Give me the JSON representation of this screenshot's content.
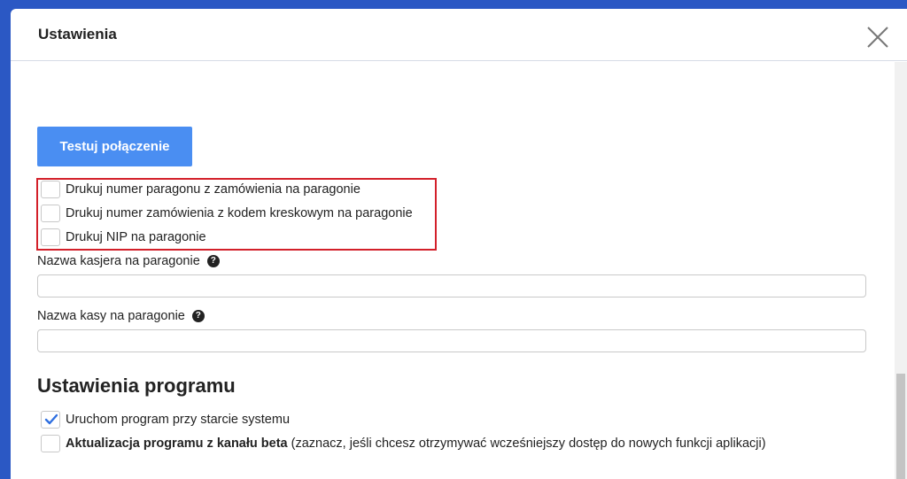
{
  "dialog": {
    "title": "Ustawienia"
  },
  "test_button": {
    "label": "Testuj połączenie"
  },
  "receipt_options": [
    {
      "label": "Drukuj numer paragonu z zamówienia na paragonie",
      "checked": false
    },
    {
      "label": "Drukuj numer zamówienia z kodem kreskowym na paragonie",
      "checked": false
    },
    {
      "label": "Drukuj NIP na paragonie",
      "checked": false
    }
  ],
  "fields": {
    "cashier_name": {
      "label": "Nazwa kasjera na paragonie",
      "value": "",
      "help_icon": "question-circle-icon"
    },
    "register_name": {
      "label": "Nazwa kasy na paragonie",
      "value": "",
      "help_icon": "question-circle-icon"
    }
  },
  "program_settings": {
    "title": "Ustawienia programu",
    "start_with_system": {
      "label": "Uruchom program przy starcie systemu",
      "checked": true
    },
    "beta_updates": {
      "label_bold": "Aktualizacja programu z kanału beta",
      "label_rest": " (zaznacz, jeśli chcesz otrzymywać wcześniejszy dostęp do nowych funkcji aplikacji)",
      "checked": false
    }
  },
  "colors": {
    "accent": "#4a8ef2",
    "highlight_border": "#d3202a",
    "background": "#2b58c4"
  }
}
